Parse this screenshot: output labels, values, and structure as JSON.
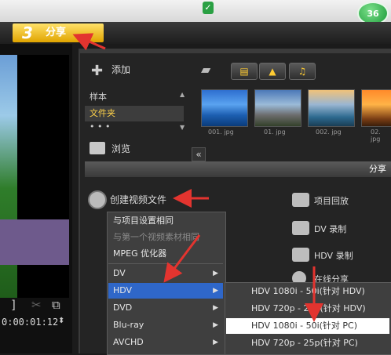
{
  "topbar": {
    "badge": "36"
  },
  "step": {
    "number": "3",
    "label": "分享"
  },
  "library": {
    "add_label": "添加",
    "categories": [
      "样本",
      "文件夹",
      "• • •"
    ],
    "browse_label": "浏览",
    "thumbnails": [
      {
        "caption": "001. jpg"
      },
      {
        "caption": "01. jpg"
      },
      {
        "caption": "002. jpg"
      },
      {
        "caption": "02. jpg"
      }
    ]
  },
  "share": {
    "bar_label": "分享",
    "create_video_label": "创建视频文件",
    "options": [
      "项目回放",
      "DV 录制",
      "HDV 录制",
      "在线分享"
    ]
  },
  "preview": {
    "timecode": "0:00:01:12"
  },
  "menu": {
    "items": [
      {
        "label": "与项目设置相同",
        "arrow": false
      },
      {
        "label": "与第一个视频素材相同",
        "arrow": false
      },
      {
        "label": "MPEG 优化器",
        "arrow": false
      },
      {
        "label": "DV",
        "arrow": true
      },
      {
        "label": "HDV",
        "arrow": true
      },
      {
        "label": "DVD",
        "arrow": true
      },
      {
        "label": "Blu-ray",
        "arrow": true
      },
      {
        "label": "AVCHD",
        "arrow": true
      }
    ]
  },
  "submenu": {
    "items": [
      "HDV 1080i - 50i(针对 HDV)",
      "HDV 720p - 25p(针对 HDV)",
      "HDV 1080i - 50i(针对 PC)",
      "HDV 720p - 25p(针对 PC)"
    ]
  },
  "colors": {
    "accent": "#ffcc33",
    "highlight": "#2f67c9",
    "arrow": "#e3342f"
  }
}
